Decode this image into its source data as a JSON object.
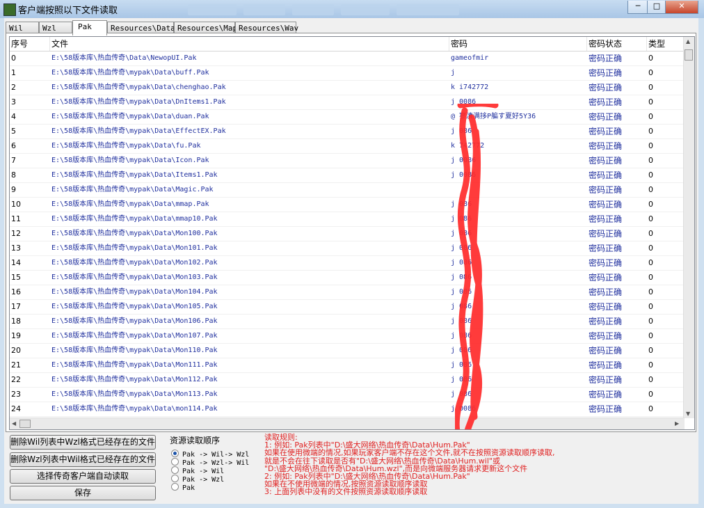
{
  "window": {
    "title": "客户端按照以下文件读取",
    "minimize": "─",
    "maximize": "□",
    "close": "✕"
  },
  "tabs": [
    "Wil",
    "Wzl",
    "Pak",
    "Resources\\Data",
    "Resources\\Map",
    "Resources\\Wav"
  ],
  "active_tab": "Pak",
  "table": {
    "columns": [
      "序号",
      "文件",
      "密码",
      "密码状态",
      "类型"
    ],
    "rows": [
      {
        "idx": "0",
        "file": "E:\\58版本库\\热血传奇\\Data\\NewopUI.Pak",
        "pwd": "gameofmir",
        "status": "密码正确",
        "type": "0"
      },
      {
        "idx": "1",
        "file": "E:\\58版本库\\热血传奇\\mypak\\Data\\buff.Pak",
        "pwd": "j",
        "status": "密码正确",
        "type": "0"
      },
      {
        "idx": "2",
        "file": "E:\\58版本库\\热血传奇\\mypak\\Data\\chenghao.Pak",
        "pwd": "k         i742772",
        "status": "密码正确",
        "type": "0"
      },
      {
        "idx": "3",
        "file": "E:\\58版本库\\热血传奇\\mypak\\Data\\DnItems1.Pak",
        "pwd": "j         0086",
        "status": "密码正确",
        "type": "0"
      },
      {
        "idx": "4",
        "file": "E:\\58版本库\\热血传奇\\mypak\\Data\\duan.Pak",
        "pwd": "@     寥漬满拸P艑す夏好5Y36",
        "status": "密码正确",
        "type": "0"
      },
      {
        "idx": "5",
        "file": "E:\\58版本库\\热血传奇\\mypak\\Data\\EffectEX.Pak",
        "pwd": "j         086",
        "status": "密码正确",
        "type": "0"
      },
      {
        "idx": "6",
        "file": "E:\\58版本库\\热血传奇\\mypak\\Data\\fu.Pak",
        "pwd": "k         742772",
        "status": "密码正确",
        "type": "0"
      },
      {
        "idx": "7",
        "file": "E:\\58版本库\\热血传奇\\mypak\\Data\\Icon.Pak",
        "pwd": "j         0086",
        "status": "密码正确",
        "type": "0"
      },
      {
        "idx": "8",
        "file": "E:\\58版本库\\热血传奇\\mypak\\Data\\Items1.Pak",
        "pwd": "j         0086",
        "status": "密码正确",
        "type": "0"
      },
      {
        "idx": "9",
        "file": "E:\\58版本库\\热血传奇\\mypak\\Data\\Magic.Pak",
        "pwd": "",
        "status": "密码正确",
        "type": "0"
      },
      {
        "idx": "10",
        "file": "E:\\58版本库\\热血传奇\\mypak\\Data\\mmap.Pak",
        "pwd": "j         086",
        "status": "密码正确",
        "type": "0"
      },
      {
        "idx": "11",
        "file": "E:\\58版本库\\热血传奇\\mypak\\Data\\mmap10.Pak",
        "pwd": "j         086",
        "status": "密码正确",
        "type": "0"
      },
      {
        "idx": "12",
        "file": "E:\\58版本库\\热血传奇\\mypak\\Data\\Mon100.Pak",
        "pwd": "j         086",
        "status": "密码正确",
        "type": "0"
      },
      {
        "idx": "13",
        "file": "E:\\58版本库\\热血传奇\\mypak\\Data\\Mon101.Pak",
        "pwd": "j         086",
        "status": "密码正确",
        "type": "0"
      },
      {
        "idx": "14",
        "file": "E:\\58版本库\\热血传奇\\mypak\\Data\\Mon102.Pak",
        "pwd": "j         086",
        "status": "密码正确",
        "type": "0"
      },
      {
        "idx": "15",
        "file": "E:\\58版本库\\热血传奇\\mypak\\Data\\Mon103.Pak",
        "pwd": "j         086",
        "status": "密码正确",
        "type": "0"
      },
      {
        "idx": "16",
        "file": "E:\\58版本库\\热血传奇\\mypak\\Data\\Mon104.Pak",
        "pwd": "j         086",
        "status": "密码正确",
        "type": "0"
      },
      {
        "idx": "17",
        "file": "E:\\58版本库\\热血传奇\\mypak\\Data\\Mon105.Pak",
        "pwd": "j         086",
        "status": "密码正确",
        "type": "0"
      },
      {
        "idx": "18",
        "file": "E:\\58版本库\\热血传奇\\mypak\\Data\\Mon106.Pak",
        "pwd": "j         086",
        "status": "密码正确",
        "type": "0"
      },
      {
        "idx": "19",
        "file": "E:\\58版本库\\热血传奇\\mypak\\Data\\Mon107.Pak",
        "pwd": "j         086",
        "status": "密码正确",
        "type": "0"
      },
      {
        "idx": "20",
        "file": "E:\\58版本库\\热血传奇\\mypak\\Data\\Mon110.Pak",
        "pwd": "j         086",
        "status": "密码正确",
        "type": "0"
      },
      {
        "idx": "21",
        "file": "E:\\58版本库\\热血传奇\\mypak\\Data\\Mon111.Pak",
        "pwd": "j         086",
        "status": "密码正确",
        "type": "0"
      },
      {
        "idx": "22",
        "file": "E:\\58版本库\\热血传奇\\mypak\\Data\\Mon112.Pak",
        "pwd": "j         086",
        "status": "密码正确",
        "type": "0"
      },
      {
        "idx": "23",
        "file": "E:\\58版本库\\热血传奇\\mypak\\Data\\Mon113.Pak",
        "pwd": "j         086",
        "status": "密码正确",
        "type": "0"
      },
      {
        "idx": "24",
        "file": "E:\\58版本库\\热血传奇\\mypak\\Data\\mon114.Pak",
        "pwd": "j         0086",
        "status": "密码正确",
        "type": "0"
      }
    ]
  },
  "buttons": {
    "delete_wil": "删除Wil列表中Wzl格式已经存在的文件",
    "delete_wzl": "删除Wzl列表中Wil格式已经存在的文件",
    "auto_read": "选择传奇客户端自动读取",
    "save": "保存"
  },
  "read_order": {
    "legend": "资源读取顺序",
    "options": [
      "Pak -> Wil-> Wzl",
      "Pak -> Wzl-> Wil",
      "Pak -> Wil",
      "Pak -> Wzl",
      "Pak"
    ],
    "selected": 0
  },
  "rules": {
    "lines": [
      "读取规则:",
      "1: 例如: Pak列表中\"D:\\盛大网络\\热血传奇\\Data\\Hum.Pak\"",
      "    如果在使用微端的情况,如果玩家客户端不存在这个文件,就不在按照资源读取顺序读取,",
      "    就是不会在往下读取是否有\"D:\\盛大网络\\热血传奇\\Data\\Hum.wil\"或",
      "    \"D:\\盛大网络\\热血传奇\\Data\\Hum.wzl\",而是向微端服务器请求更新这个文件",
      "2: 例如: Pak列表中\"D:\\盛大网络\\热血传奇\\Data\\Hum.Pak\"",
      "    如果在不使用微端的情况,按照资源读取顺序读取",
      "3: 上面列表中没有的文件按照资源读取顺序读取"
    ]
  },
  "colors": {
    "link_blue": "#1f2f9e",
    "rules_red": "#e02020",
    "redact_red": "#ff2a2a"
  }
}
